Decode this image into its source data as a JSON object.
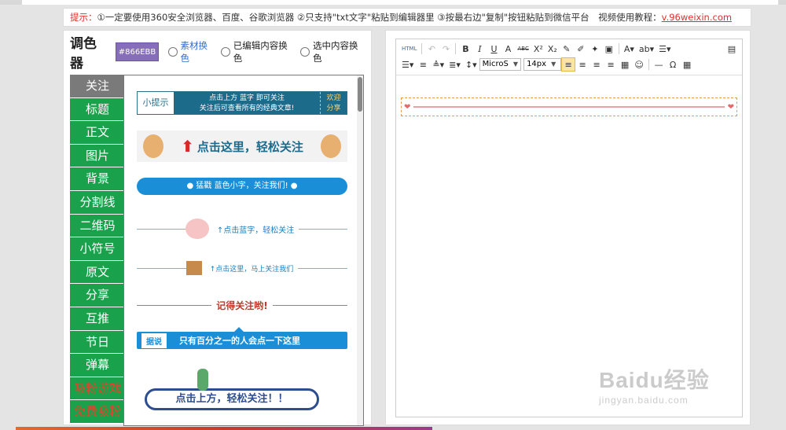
{
  "notice": {
    "prefix": "提示：",
    "text": "①一定要使用360安全浏览器、百度、谷歌浏览器 ②只支持\"txt文字\"粘贴到编辑器里 ③按最右边\"复制\"按钮粘贴到微信平台　视频使用教程：",
    "link": "v.96weixin.com"
  },
  "color_picker": {
    "title": "调色器",
    "value": "#866EBB",
    "swatch_color": "#866EBB",
    "options": [
      "素材换色",
      "已编辑内容换色",
      "选中内容换色"
    ]
  },
  "categories": [
    {
      "label": "关注",
      "state": "active"
    },
    {
      "label": "标题",
      "state": ""
    },
    {
      "label": "正文",
      "state": ""
    },
    {
      "label": "图片",
      "state": ""
    },
    {
      "label": "背景",
      "state": ""
    },
    {
      "label": "分割线",
      "state": ""
    },
    {
      "label": "二维码",
      "state": ""
    },
    {
      "label": "小符号",
      "state": ""
    },
    {
      "label": "原文",
      "state": ""
    },
    {
      "label": "分享",
      "state": ""
    },
    {
      "label": "互推",
      "state": ""
    },
    {
      "label": "节日",
      "state": ""
    },
    {
      "label": "弹幕",
      "state": ""
    },
    {
      "label": "吸粉游戏",
      "state": "special"
    },
    {
      "label": "免费吸粉",
      "state": "special"
    }
  ],
  "templates": {
    "t1": {
      "label": "小提示",
      "line1": "点击上方 蓝字 即可关注",
      "line2": "关注后可查看所有的经典文章!",
      "end1": "欢迎",
      "end2": "分享"
    },
    "t2": {
      "text": "点击这里，轻松关注"
    },
    "t3": {
      "text": "●  猛戳  蓝色小字，关注我们!  ●"
    },
    "t4": {
      "text": "↑点击蓝字，轻松关注"
    },
    "t5": {
      "text": "↑点击这里，马上关注我们"
    },
    "t6": {
      "text": "记得关注哟!"
    },
    "t7": {
      "tag": "据说",
      "text": "只有百分之一的人会点一下这里"
    },
    "t8": {
      "text": "点击上方，轻松关注！！"
    }
  },
  "toolbar": {
    "row1": [
      "HTML",
      "↶",
      "↷",
      "B",
      "I",
      "U",
      "A",
      "ABC",
      "X²",
      "X₂",
      "✎",
      "✐",
      "✦",
      "▣",
      "A▾",
      "ab▾",
      "☰▾",
      "▤"
    ],
    "row2": [
      "☰▾",
      "≡",
      "≜▾",
      "≣▾",
      "↕▾",
      "≡",
      "≡",
      "≡",
      "≡",
      "▦",
      "☺",
      "—",
      "Ω",
      "▦"
    ],
    "font_family": "MicroS",
    "font_size": "14px"
  },
  "watermark": {
    "big": "Baidu经验",
    "small": "jingyan.baidu.com"
  }
}
